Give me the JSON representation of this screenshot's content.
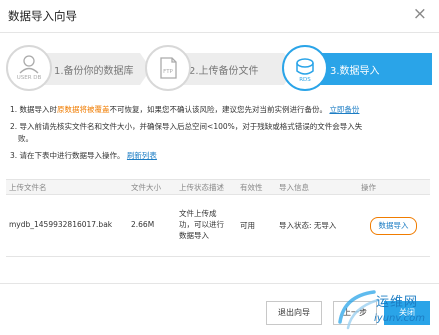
{
  "dialog": {
    "title": "数据导入向导",
    "close": "×"
  },
  "steps": [
    {
      "icon_text": "USER DB",
      "label": "1.备份你的数据库"
    },
    {
      "icon_text": "FTP",
      "label": "2.上传备份文件"
    },
    {
      "icon_text": "RDS",
      "label": "3.数据导入"
    }
  ],
  "notes": {
    "n1": {
      "a": "1. 数据导入时",
      "warn": "原数据将被覆盖",
      "b": "不可恢复，如果您不确认该风险，建议您先对当前实例进行备份。",
      "link": "立即备份"
    },
    "n2": {
      "line1": "2. 导入前请先核实文件名和文件大小，并确保导入后总空间<100%，对于残缺或格式错误的文件会导入失",
      "line2": "败。"
    },
    "n3": {
      "text": "3. 请在下表中进行数据导入操作。",
      "link": "刷新列表"
    }
  },
  "table": {
    "headers": [
      "上传文件名",
      "文件大小",
      "上传状态描述",
      "有效性",
      "导入信息",
      "操作"
    ],
    "row": {
      "filename": "mydb_1459932816017.bak",
      "size": "2.66M",
      "desc": "文件上传成功，可以进行数据导入",
      "validity": "可用",
      "info": "导入状态: 无导入",
      "action": "数据导入"
    }
  },
  "footer": {
    "exit": "退出向导",
    "prev": "上一步",
    "close": "关闭"
  },
  "watermark": {
    "text": "运维网",
    "url": "iyunv.com"
  },
  "colors": {
    "accent": "#2aa4e8",
    "warning": "#f07c00",
    "link": "#1c7dc4"
  }
}
